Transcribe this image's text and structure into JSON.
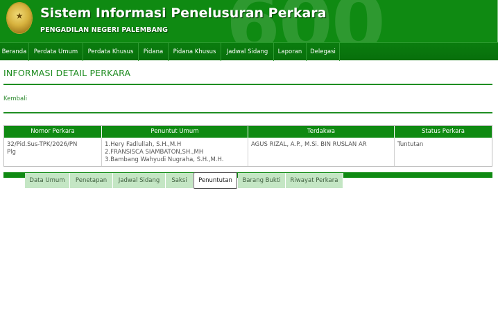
{
  "header": {
    "bg_number": "600",
    "title": "Sistem Informasi Penelusuran Perkara",
    "subtitle": "PENGADILAN NEGERI PALEMBANG",
    "brand_color": "#0f8a12"
  },
  "nav": {
    "items": [
      {
        "label": "Beranda"
      },
      {
        "label": "Perdata Umum"
      },
      {
        "label": "Perdata Khusus"
      },
      {
        "label": "Pidana"
      },
      {
        "label": "Pidana Khusus"
      },
      {
        "label": "Jadwal Sidang"
      },
      {
        "label": "Laporan"
      },
      {
        "label": "Delegasi"
      }
    ]
  },
  "page": {
    "heading": "INFORMASI DETAIL PERKARA",
    "back_link": "Kembali"
  },
  "case_table": {
    "headers": [
      "Nomor Perkara",
      "Penuntut Umum",
      "Terdakwa",
      "Status Perkara"
    ],
    "row": {
      "nomor": [
        "32/Pid.Sus-TPK/2026/PN",
        "Plg"
      ],
      "penuntut": [
        "1.Hery Fadlullah, S.H.,M.H",
        "2.FRANSISCA SIAMBATON,SH.,MH",
        "3.Bambang Wahyudi Nugraha, S.H.,M.H."
      ],
      "terdakwa": "AGUS RIZAL, A.P., M.Si. BIN RUSLAN AR",
      "status": "Tuntutan"
    }
  },
  "tabs": {
    "items": [
      {
        "label": "Data Umum"
      },
      {
        "label": "Penetapan"
      },
      {
        "label": "Jadwal Sidang"
      },
      {
        "label": "Saksi"
      },
      {
        "label": "Penuntutan"
      },
      {
        "label": "Barang Bukti"
      },
      {
        "label": "Riwayat Perkara"
      }
    ],
    "active": "Penuntutan"
  }
}
